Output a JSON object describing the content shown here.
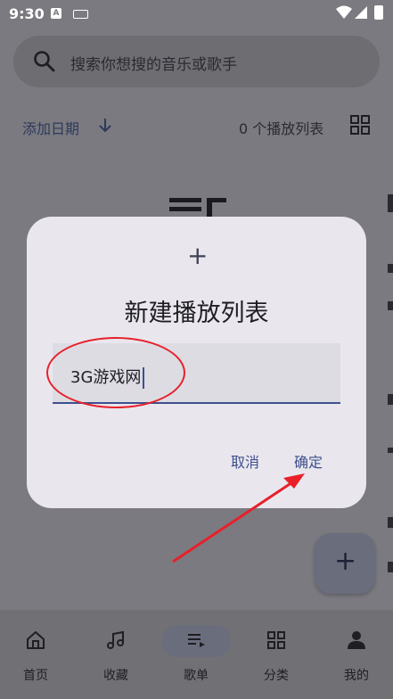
{
  "status_bar": {
    "time": "9:30",
    "a_badge": "A"
  },
  "search": {
    "placeholder": "搜索你想搜的音乐或歌手"
  },
  "sort": {
    "label": "添加日期",
    "count_text": "0 个播放列表"
  },
  "dialog": {
    "title": "新建播放列表",
    "input_value": "3G游戏网",
    "cancel_label": "取消",
    "confirm_label": "确定"
  },
  "bottom_nav": {
    "items": [
      {
        "label": "首页",
        "icon": "home-icon"
      },
      {
        "label": "收藏",
        "icon": "music-note-icon"
      },
      {
        "label": "歌单",
        "icon": "playlist-icon"
      },
      {
        "label": "分类",
        "icon": "category-grid-icon"
      },
      {
        "label": "我的",
        "icon": "person-icon"
      }
    ],
    "selected_index": 2
  },
  "colors": {
    "accent": "#3e4f8f",
    "annotation_red": "#e8202a",
    "dialog_bg": "#e9e7ed",
    "scrim": "#7b7a80"
  }
}
